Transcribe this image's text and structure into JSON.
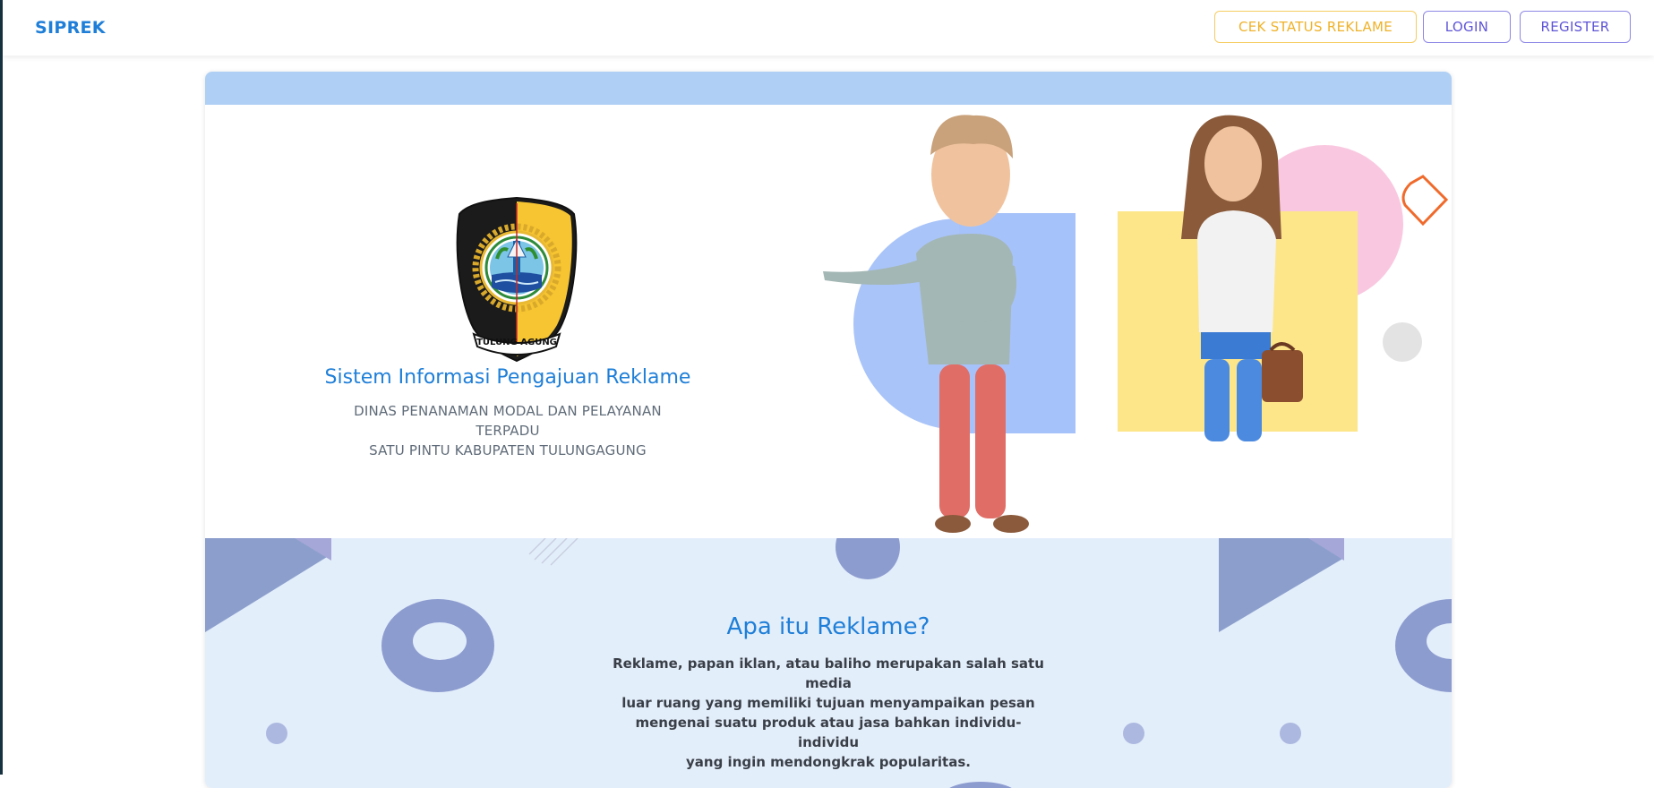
{
  "navbar": {
    "brand": "SIPREK",
    "cek_status_label": "CEK STATUS REKLAME",
    "login_label": "LOGIN",
    "register_label": "REGISTER"
  },
  "hero": {
    "logo_text": "TULUNG AGUNG",
    "title": "Sistem Informasi Pengajuan Reklame",
    "subtitle_line1": "DINAS PENANAMAN MODAL DAN PELAYANAN TERPADU",
    "subtitle_line2": "SATU PINTU KABUPATEN TULUNGAGUNG"
  },
  "about": {
    "title": "Apa itu Reklame?",
    "line1": "Reklame, papan iklan, atau baliho merupakan salah satu media",
    "line2": "luar ruang yang memiliki tujuan menyampaikan pesan",
    "line3": "mengenai suatu produk atau jasa bahkan individu-individu",
    "line4": "yang ingin mendongkrak popularitas."
  },
  "colors": {
    "brand_blue": "#1f7fd8",
    "cek_yellow": "#efb22a",
    "login_purple": "#5f55d6",
    "strip_blue": "#afd0f4",
    "section_bg": "#e3eefb"
  },
  "icons": {
    "logo": "tulungagung-coat-of-arms",
    "illustration": "two-3d-people-illustration"
  }
}
